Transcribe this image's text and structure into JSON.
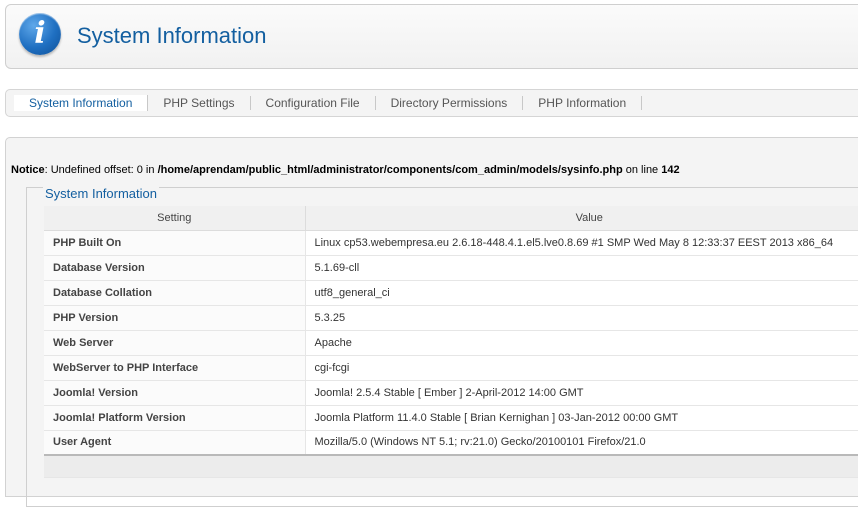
{
  "header": {
    "title": "System Information"
  },
  "tabs": [
    {
      "label": "System Information",
      "active": true
    },
    {
      "label": "PHP Settings",
      "active": false
    },
    {
      "label": "Configuration File",
      "active": false
    },
    {
      "label": "Directory Permissions",
      "active": false
    },
    {
      "label": "PHP Information",
      "active": false
    }
  ],
  "notice": {
    "prefix": "Notice",
    "text": ": Undefined offset: 0 in ",
    "path": "/home/aprendam/public_html/administrator/components/com_admin/models/sysinfo.php",
    "on_line": " on line ",
    "line": "142"
  },
  "fieldset": {
    "legend": "System Information"
  },
  "table": {
    "headers": [
      "Setting",
      "Value"
    ],
    "rows": [
      {
        "setting": "PHP Built On",
        "value": "Linux cp53.webempresa.eu 2.6.18-448.4.1.el5.lve0.8.69 #1 SMP Wed May 8 12:33:37 EEST 2013 x86_64"
      },
      {
        "setting": "Database Version",
        "value": "5.1.69-cll"
      },
      {
        "setting": "Database Collation",
        "value": "utf8_general_ci"
      },
      {
        "setting": "PHP Version",
        "value": "5.3.25"
      },
      {
        "setting": "Web Server",
        "value": "Apache"
      },
      {
        "setting": "WebServer to PHP Interface",
        "value": "cgi-fcgi"
      },
      {
        "setting": "Joomla! Version",
        "value": "Joomla! 2.5.4 Stable [ Ember ] 2-April-2012 14:00 GMT"
      },
      {
        "setting": "Joomla! Platform Version",
        "value": "Joomla Platform 11.4.0 Stable [ Brian Kernighan ] 03-Jan-2012 00:00 GMT"
      },
      {
        "setting": "User Agent",
        "value": "Mozilla/5.0 (Windows NT 5.1; rv:21.0) Gecko/20100101 Firefox/21.0"
      }
    ]
  },
  "icons": {
    "header_icon": "info-icon"
  },
  "colors": {
    "accent": "#135fa0"
  }
}
